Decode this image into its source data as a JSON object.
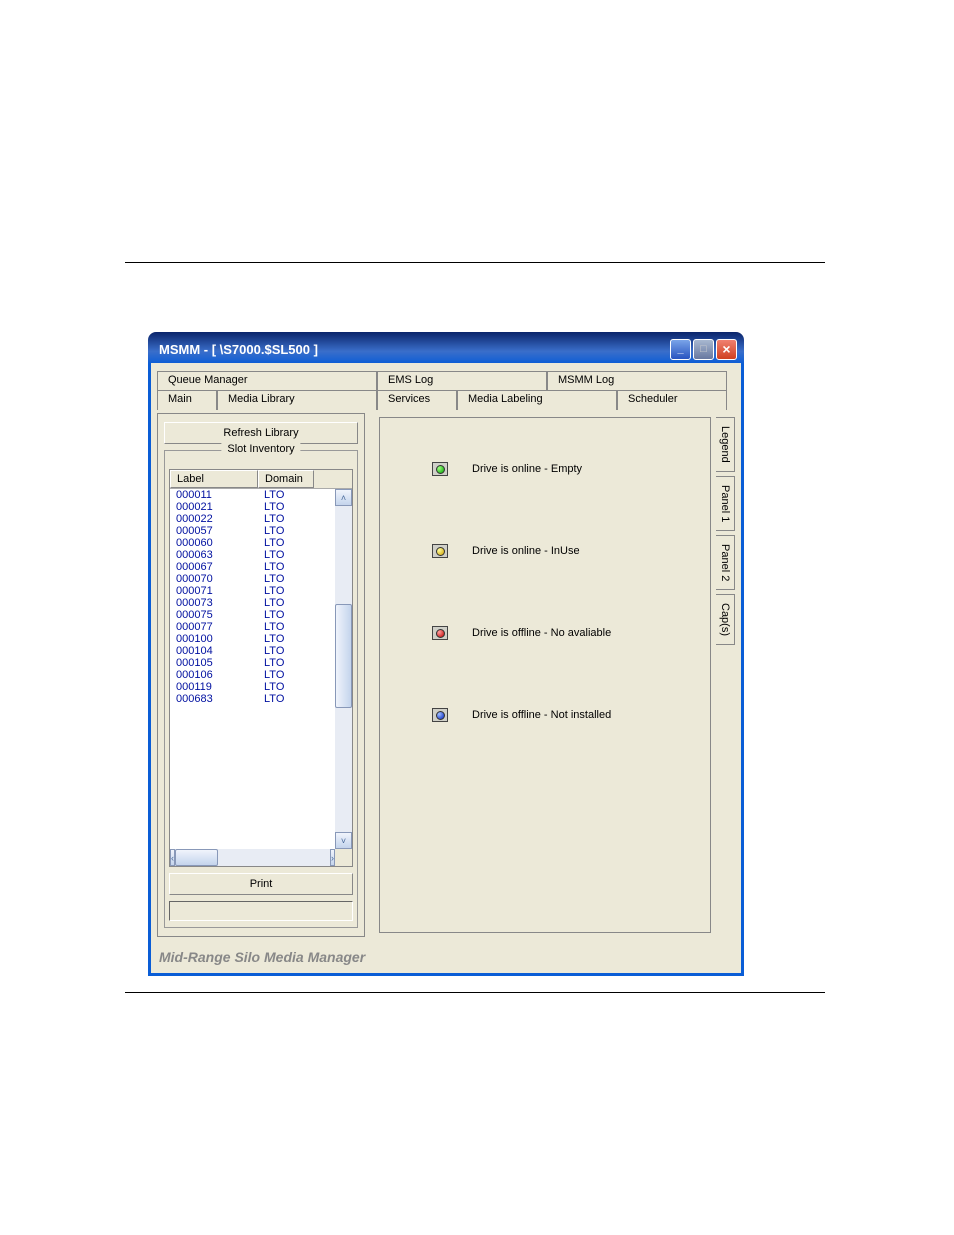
{
  "window": {
    "title": "MSMM - [ \\S7000.$SL500 ]"
  },
  "tabs_row1": {
    "t0": "Queue Manager",
    "t1": "EMS Log",
    "t2": "MSMM Log"
  },
  "tabs_row2": {
    "t0": "Main",
    "t1": "Media Library",
    "t2": "Services",
    "t3": "Media Labeling",
    "t4": "Scheduler"
  },
  "left": {
    "refresh": "Refresh Library",
    "group_title": "Slot Inventory",
    "header_label": "Label",
    "header_domain": "Domain",
    "print": "Print",
    "rows": [
      {
        "label": "000011",
        "domain": "LTO"
      },
      {
        "label": "000021",
        "domain": "LTO"
      },
      {
        "label": "000022",
        "domain": "LTO"
      },
      {
        "label": "000057",
        "domain": "LTO"
      },
      {
        "label": "000060",
        "domain": "LTO"
      },
      {
        "label": "000063",
        "domain": "LTO"
      },
      {
        "label": "000067",
        "domain": "LTO"
      },
      {
        "label": "000070",
        "domain": "LTO"
      },
      {
        "label": "000071",
        "domain": "LTO"
      },
      {
        "label": "000073",
        "domain": "LTO"
      },
      {
        "label": "000075",
        "domain": "LTO"
      },
      {
        "label": "000077",
        "domain": "LTO"
      },
      {
        "label": "000100",
        "domain": "LTO"
      },
      {
        "label": "000104",
        "domain": "LTO"
      },
      {
        "label": "000105",
        "domain": "LTO"
      },
      {
        "label": "000106",
        "domain": "LTO"
      },
      {
        "label": "000119",
        "domain": "LTO"
      },
      {
        "label": "000683",
        "domain": "LTO"
      }
    ]
  },
  "vtabs": {
    "t0": "Legend",
    "t1": "Panel 1",
    "t2": "Panel 2",
    "t3": "Cap(s)"
  },
  "legend": {
    "i0": "Drive is online - Empty",
    "i1": "Drive is online - InUse",
    "i2": "Drive is offline - No avaliable",
    "i3": "Drive is offline - Not installed"
  },
  "footer": "Mid-Range Silo Media Manager"
}
